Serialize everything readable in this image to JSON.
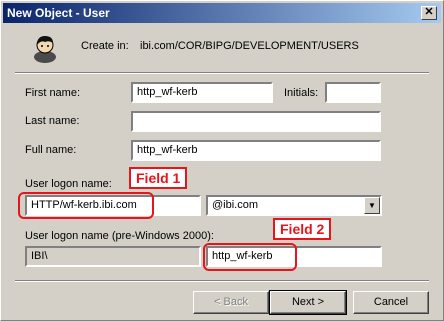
{
  "window": {
    "title": "New Object - User",
    "close_glyph": "✕"
  },
  "header": {
    "create_in_label": "Create in:",
    "create_in_path": "ibi.com/COR/BIPG/DEVELOPMENT/USERS"
  },
  "form": {
    "first_name_label": "First name:",
    "first_name_value": "http_wf-kerb",
    "initials_label": "Initials:",
    "initials_value": "",
    "last_name_label": "Last name:",
    "last_name_value": "",
    "full_name_label": "Full name:",
    "full_name_value": "http_wf-kerb",
    "logon_name_label": "User logon name:",
    "logon_name_value": "HTTP/wf-kerb.ibi.com",
    "domain_value": "@ibi.com",
    "pre2000_label": "User logon name (pre-Windows 2000):",
    "pre2000_domain": "IBI\\",
    "pre2000_value": "http_wf-kerb"
  },
  "callouts": {
    "field1": "Field 1",
    "field2": "Field 2",
    "color": "#e8141c"
  },
  "buttons": {
    "back": "< Back",
    "next": "Next >",
    "cancel": "Cancel"
  },
  "colors": {
    "dialog_bg": "#d4d0c8",
    "title_start": "#0a246a",
    "title_end": "#a6caf0"
  }
}
